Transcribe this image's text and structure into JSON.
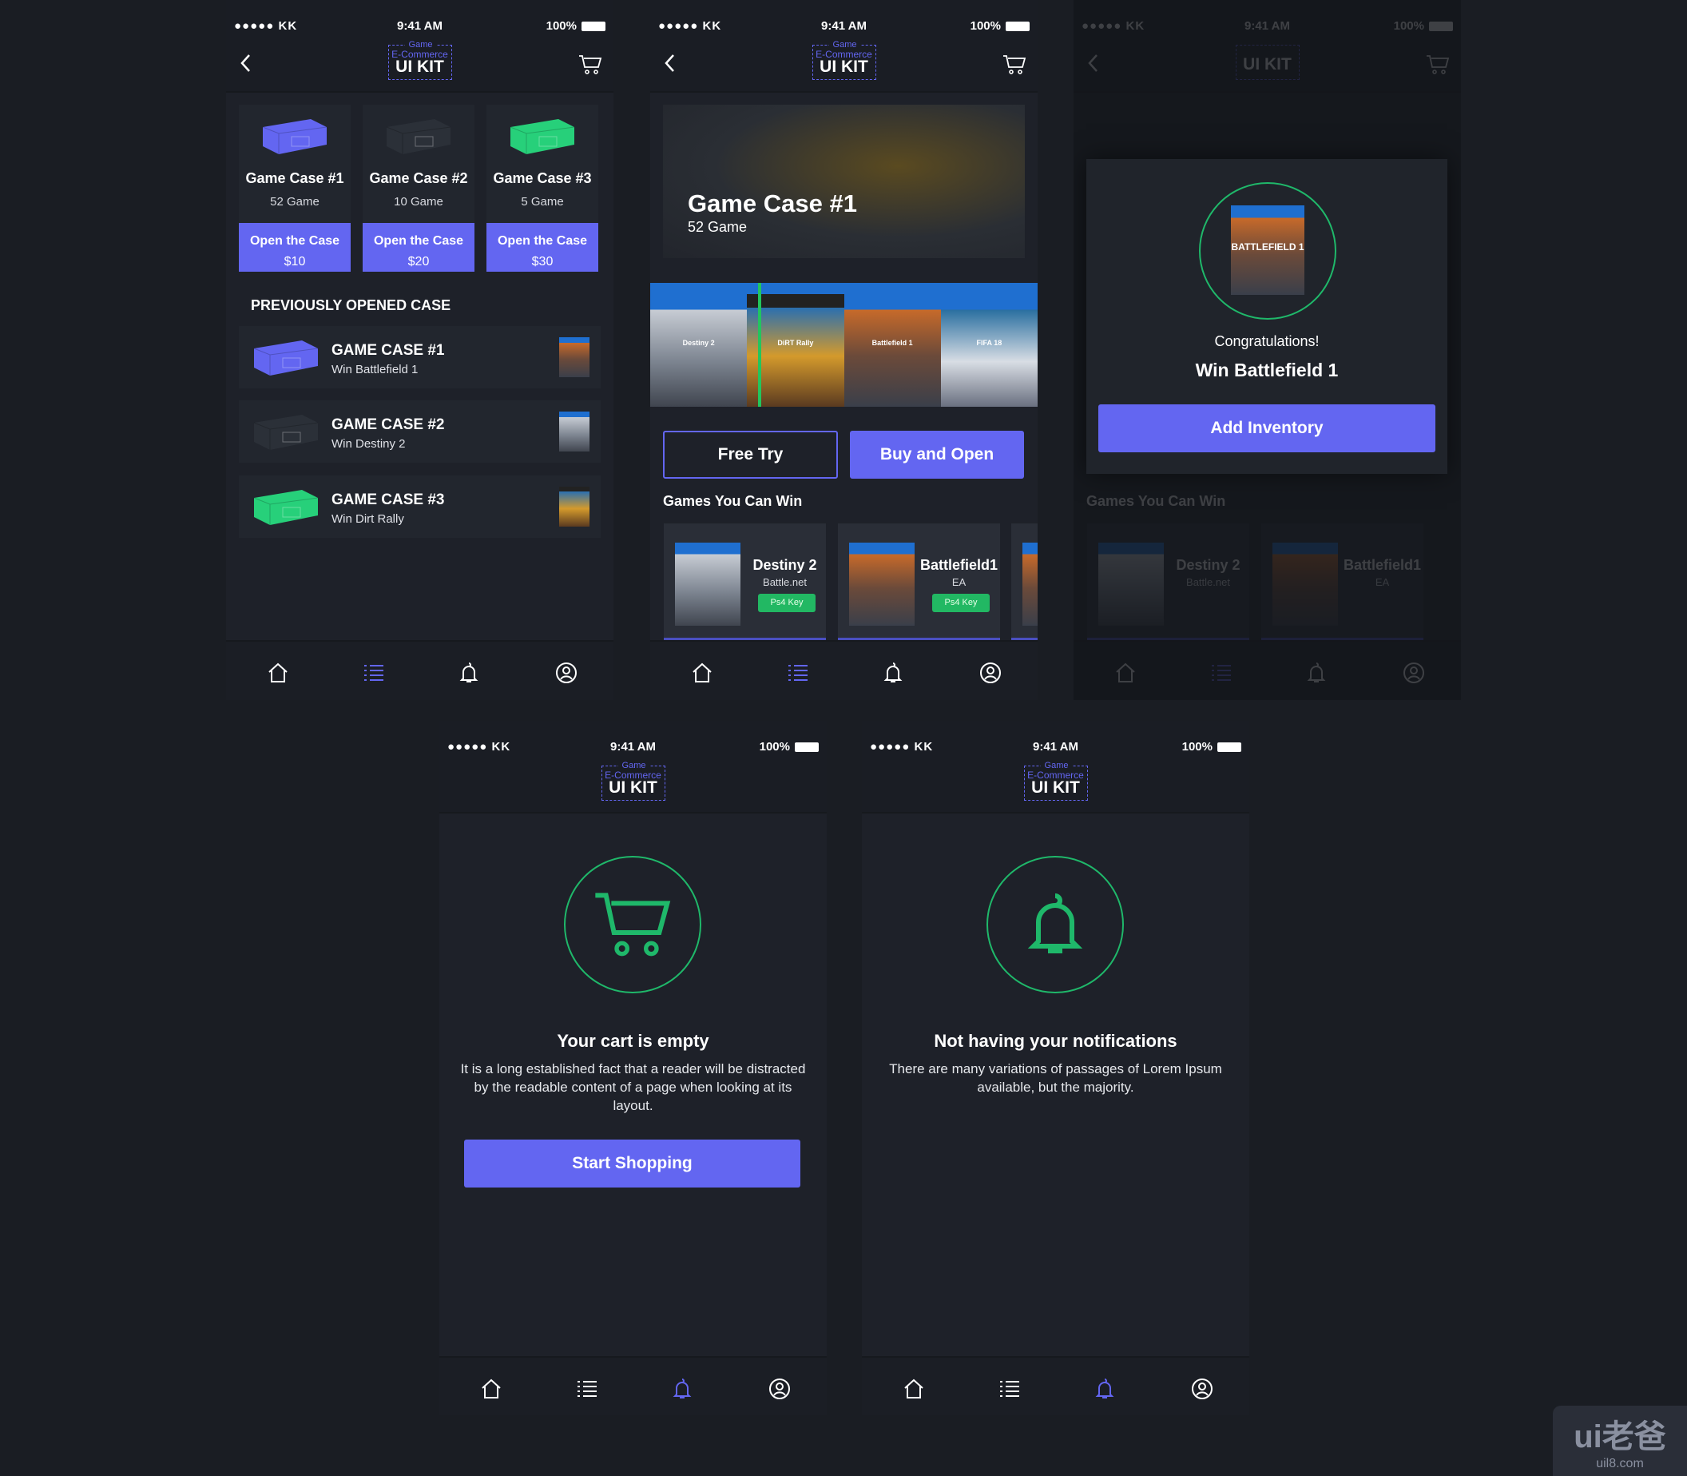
{
  "status": {
    "carrier": "KK",
    "signal": "●●●●●",
    "time": "9:41 AM",
    "battery": "100%"
  },
  "logo": {
    "line1": "Game",
    "line2": "E-Commerce",
    "line3": "UI KIT"
  },
  "colors": {
    "accent": "#6366f1",
    "green": "#22c55e",
    "bg": "#1a1d23"
  },
  "tabbar": {
    "items": [
      "home-icon",
      "list-icon",
      "bell-icon",
      "profile-icon"
    ]
  },
  "cases": [
    {
      "title": "Game Case #1",
      "count": "52 Game",
      "button": "Open the Case",
      "price": "$10",
      "color": "#6366f1"
    },
    {
      "title": "Game Case #2",
      "count": "10 Game",
      "button": "Open the Case",
      "price": "$20",
      "color": "#2b3038"
    },
    {
      "title": "Game Case #3",
      "count": "5 Game",
      "button": "Open the Case",
      "price": "$30",
      "color": "#27d07a"
    }
  ],
  "previous": {
    "heading": "PREVIOUSLY OPENED CASE",
    "rows": [
      {
        "title": "GAME CASE #1",
        "sub": "Win Battlefield 1"
      },
      {
        "title": "GAME CASE #2",
        "sub": "Win Destiny 2"
      },
      {
        "title": "GAME CASE #3",
        "sub": "Win Dirt Rally"
      }
    ]
  },
  "detail": {
    "title": "Game Case #1",
    "sub": "52 Game",
    "carousel": [
      "Destiny 2",
      "DiRT Rally",
      "Battlefield 1",
      "FIFA 18"
    ],
    "free_try": "Free Try",
    "buy": "Buy and Open",
    "games_heading": "Games You Can Win",
    "games": [
      {
        "title": "Destiny 2",
        "publisher": "Battle.net",
        "badge": "Ps4 Key"
      },
      {
        "title": "Battlefield1",
        "publisher": "EA",
        "badge": "Ps4 Key"
      }
    ]
  },
  "win": {
    "congrats": "Congratulations!",
    "prize": "Win Battlefield 1",
    "button": "Add Inventory",
    "cover": "BATTLEFIELD 1"
  },
  "cart_empty": {
    "title": "Your cart is empty",
    "text": "It is a long established fact that a reader will be distracted by the readable content of a page when looking at its layout.",
    "button": "Start Shopping"
  },
  "notif_empty": {
    "title": "Not having your notifications",
    "text": "There are many variations of passages of Lorem Ipsum available, but the majority."
  },
  "watermark": {
    "brand": "ui老爸",
    "site": "uil8.com"
  }
}
